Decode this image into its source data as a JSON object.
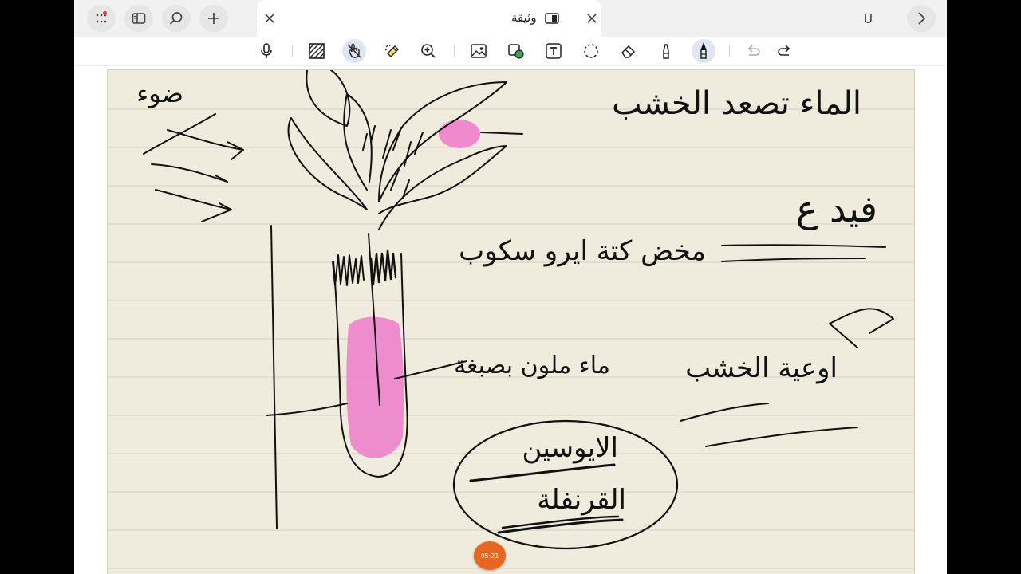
{
  "tabbar": {
    "tab_title": "وثيقة",
    "right_label": "U"
  },
  "toolbar": {
    "tools": [
      "microphone-icon",
      "pattern-icon",
      "hand-touch-icon",
      "highlighter-eraser-icon",
      "zoom-icon",
      "image-icon",
      "shape-icon",
      "text-icon",
      "lasso-icon",
      "eraser-icon",
      "marker-icon",
      "pen-icon",
      "undo-icon",
      "redo-icon"
    ]
  },
  "canvas": {
    "handwriting": {
      "top_right": "الماء تصعد الخشب",
      "top_left": "ضوء",
      "mid_right": "فيد ع",
      "mid_center": "مخض كتة ايرو سكوب",
      "tube_label": "ماء ملون بصبغة",
      "dye_1": "الايوسين",
      "dye_2": "القرنفلة",
      "right_note": "اوعية الخشب"
    },
    "timer": "05:21"
  },
  "colors": {
    "ink": "#111111",
    "pink": "#ee7fcb",
    "paper": "#efecdd",
    "rule": "#d4d0c0",
    "timer": "#e8661d"
  }
}
